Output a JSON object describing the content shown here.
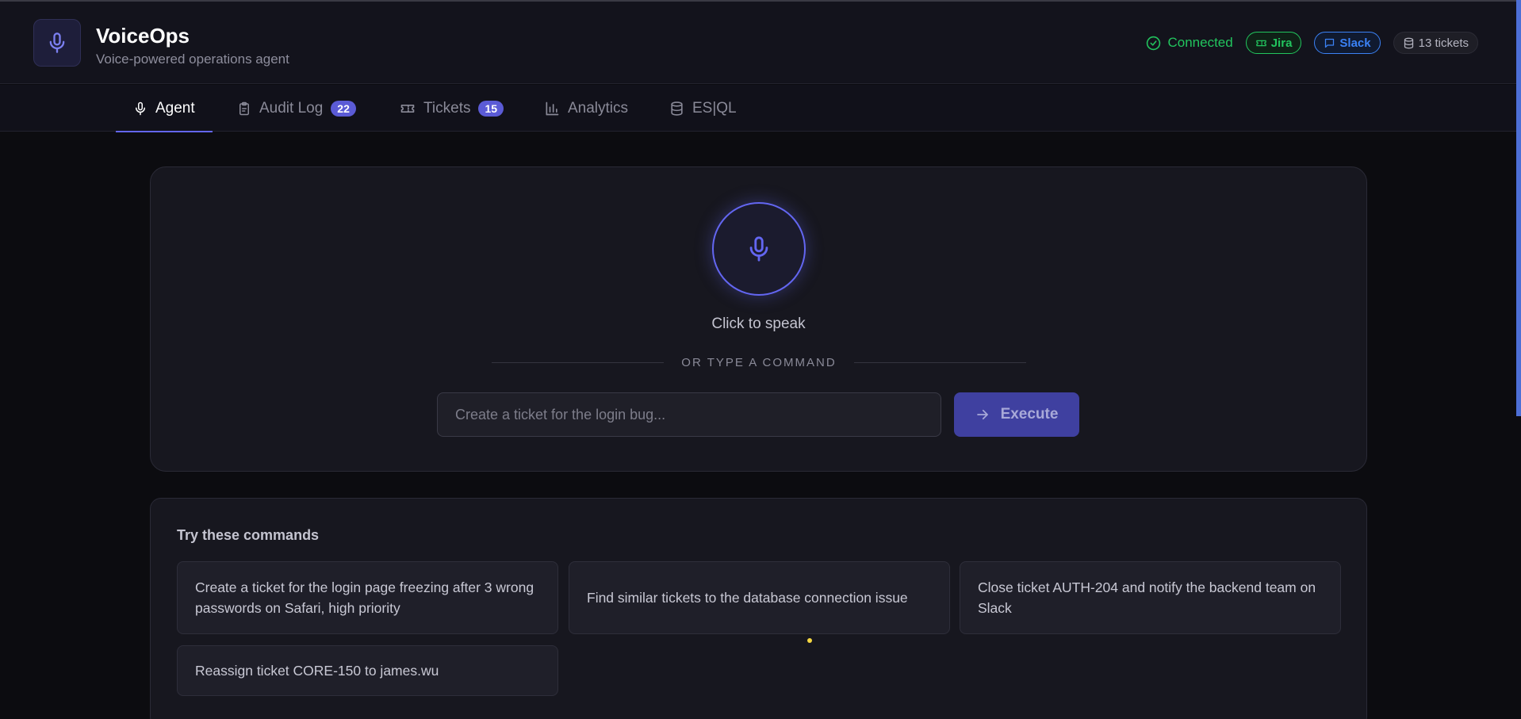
{
  "app": {
    "title": "VoiceOps",
    "subtitle": "Voice-powered operations agent"
  },
  "status": {
    "connection": "Connected",
    "integrations": [
      {
        "label": "Jira",
        "icon": "ticket-icon",
        "color": "#22c55e"
      },
      {
        "label": "Slack",
        "icon": "chat-icon",
        "color": "#3b82f6"
      }
    ],
    "tickets_count": "13 tickets"
  },
  "tabs": [
    {
      "label": "Agent",
      "icon": "mic-icon",
      "active": true
    },
    {
      "label": "Audit Log",
      "icon": "clipboard-icon",
      "badge": "22"
    },
    {
      "label": "Tickets",
      "icon": "ticket-icon",
      "badge": "15"
    },
    {
      "label": "Analytics",
      "icon": "bar-chart-icon"
    },
    {
      "label": "ES|QL",
      "icon": "database-icon"
    }
  ],
  "agent": {
    "mic_label": "Click to speak",
    "divider_text": "OR TYPE A COMMAND",
    "input_placeholder": "Create a ticket for the login bug...",
    "input_value": "",
    "execute_label": "Execute"
  },
  "commands": {
    "title": "Try these commands",
    "items": [
      "Create a ticket for the login page freezing after 3 wrong passwords on Safari, high priority",
      "Find similar tickets to the database connection issue",
      "Close ticket AUTH-204 and notify the backend team on Slack",
      "Reassign ticket CORE-150 to james.wu"
    ]
  },
  "colors": {
    "accent": "#6366f1",
    "success": "#22c55e",
    "slack": "#3b82f6",
    "background": "#0c0c10"
  }
}
